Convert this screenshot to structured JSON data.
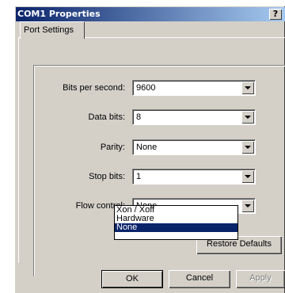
{
  "window": {
    "title": "COM1 Properties",
    "help_label": "?"
  },
  "tabs": [
    {
      "label": "Port Settings",
      "active": true
    }
  ],
  "fields": [
    {
      "label": "Bits per second:",
      "value": "9600"
    },
    {
      "label": "Data bits:",
      "value": "8"
    },
    {
      "label": "Parity:",
      "value": "None"
    },
    {
      "label": "Stop bits:",
      "value": "1"
    },
    {
      "label": "Flow control:",
      "value": "None"
    }
  ],
  "flow_control_dropdown": {
    "options": [
      "Xon / Xoff",
      "Hardware",
      "None"
    ],
    "selected": "None"
  },
  "buttons": {
    "restore_defaults": "Restore Defaults",
    "ok": "OK",
    "cancel": "Cancel",
    "apply": "Apply"
  },
  "colors": {
    "dialog_face": "#d4d0c8",
    "titlebar_start": "#0a246a",
    "titlebar_end": "#a6caf0",
    "selection": "#0a246a"
  }
}
